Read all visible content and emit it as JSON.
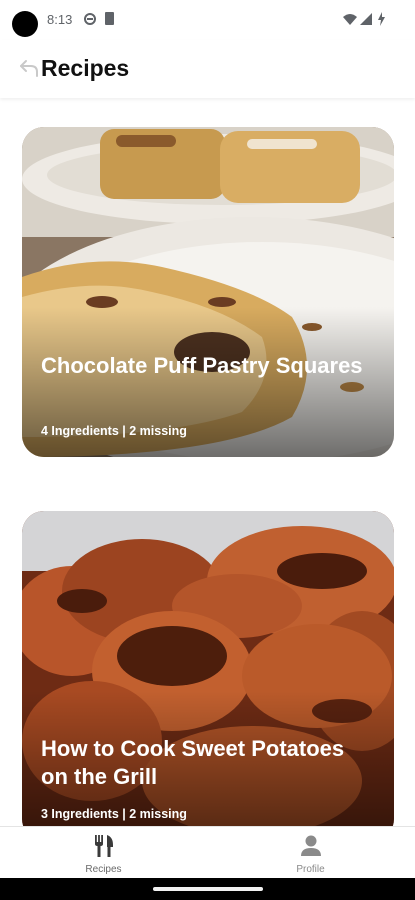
{
  "status_bar": {
    "time": "8:13"
  },
  "app_bar": {
    "title": "Recipes"
  },
  "recipes": [
    {
      "title": "Chocolate Puff Pastry Squares",
      "meta": "4 Ingredients | 2 missing"
    },
    {
      "title": "How to Cook Sweet Potatoes on the Grill",
      "meta": "3 Ingredients | 2 missing"
    }
  ],
  "bottom_nav": {
    "items": [
      {
        "label": "Recipes",
        "icon": "fork-knife-icon"
      },
      {
        "label": "Profile",
        "icon": "person-icon"
      }
    ]
  },
  "colors": {
    "background": "#ffffff",
    "nav_active": "#3a3a3a",
    "nav_inactive": "#8a8a8a"
  }
}
